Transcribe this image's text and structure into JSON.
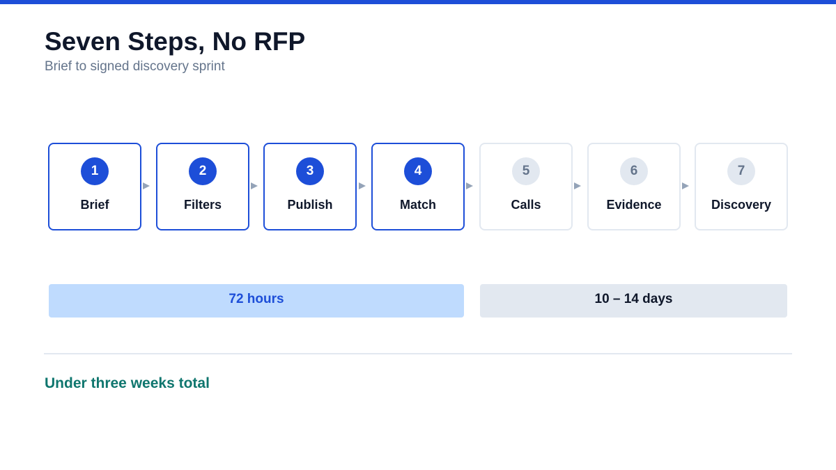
{
  "header": {
    "title": "Seven Steps, No RFP",
    "subtitle": "Brief to signed discovery sprint"
  },
  "steps": [
    {
      "number": "1",
      "label": "Brief",
      "state": "active"
    },
    {
      "number": "2",
      "label": "Filters",
      "state": "active"
    },
    {
      "number": "3",
      "label": "Publish",
      "state": "active"
    },
    {
      "number": "4",
      "label": "Match",
      "state": "active"
    },
    {
      "number": "5",
      "label": "Calls",
      "state": "pending"
    },
    {
      "number": "6",
      "label": "Evidence",
      "state": "pending"
    },
    {
      "number": "7",
      "label": "Discovery",
      "state": "pending"
    }
  ],
  "phases": [
    {
      "label": "72 hours",
      "color": "#bfdbfe"
    },
    {
      "label": "10 – 14 days",
      "color": "#e2e8f0"
    }
  ],
  "footer": {
    "total": "Under three weeks total"
  },
  "colors": {
    "accent": "#1d4ed8",
    "pending": "#e2e8f0",
    "total_text": "#0f766e"
  }
}
